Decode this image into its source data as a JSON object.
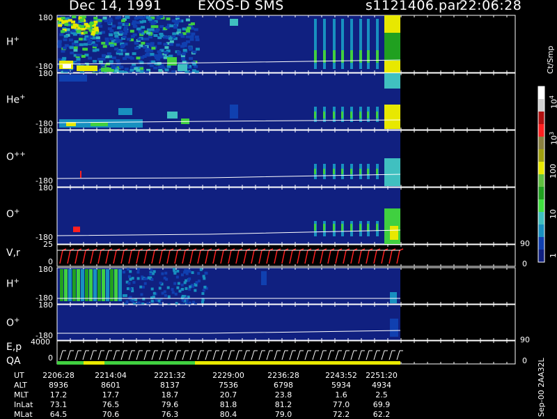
{
  "header": {
    "date": "Dec 14, 1991",
    "mission": "EXOS-D SMS",
    "file": "s1121406.par",
    "time": "22:06:28"
  },
  "panels": [
    {
      "label": "H",
      "sup": "+",
      "ymax": "180",
      "ymin": "-180"
    },
    {
      "label": "He",
      "sup": "+",
      "ymax": "180",
      "ymin": "-180"
    },
    {
      "label": "O",
      "sup": "++",
      "ymax": "180",
      "ymin": "-180"
    },
    {
      "label": "O",
      "sup": "+",
      "ymax": "180",
      "ymin": "-180"
    },
    {
      "label": "V,r",
      "sup": "",
      "ymax": "25",
      "ymin": "0",
      "right_top": "90",
      "right_bottom": "0"
    },
    {
      "label": "H",
      "sup": "+",
      "ymax": "180",
      "ymin": "-180"
    },
    {
      "label": "O",
      "sup": "+",
      "ymax": "180",
      "ymin": "-180"
    },
    {
      "label": "E,p",
      "label2": "QA",
      "ymax": "4000",
      "ymin": "0",
      "right_top": "90",
      "right_bottom": "0"
    }
  ],
  "colorbar": {
    "title": "Ct/Smp",
    "ticks": [
      "10^4",
      "10^3",
      "100",
      "10",
      "1"
    ],
    "colors": [
      "#ffffff",
      "#d0d0d0",
      "#b01010",
      "#ff2020",
      "#8a8040",
      "#a0a010",
      "#e8e800",
      "#60c040",
      "#20a020",
      "#40e040",
      "#40c0c0",
      "#1890c0",
      "#1040b0",
      "#102080"
    ]
  },
  "footer": {
    "version": "Sep-00 2AA32L",
    "row_labels": [
      "UT",
      "ALT",
      "MLT",
      "InLat",
      "MLat"
    ],
    "columns": [
      {
        "UT": "2206:28",
        "ALT": "8936",
        "MLT": "17.2",
        "InLat": "73.1",
        "MLat": "64.5"
      },
      {
        "UT": "2214:04",
        "ALT": "8601",
        "MLT": "17.7",
        "InLat": "76.5",
        "MLat": "70.6"
      },
      {
        "UT": "2221:32",
        "ALT": "8137",
        "MLT": "18.7",
        "InLat": "79.6",
        "MLat": "76.3"
      },
      {
        "UT": "2229:00",
        "ALT": "7536",
        "MLT": "20.7",
        "InLat": "81.8",
        "MLat": "80.4"
      },
      {
        "UT": "2236:28",
        "ALT": "6798",
        "MLT": "23.8",
        "InLat": "81.2",
        "MLat": "79.0"
      },
      {
        "UT": "2243:52",
        "ALT": "5934",
        "MLT": "1.6",
        "InLat": "77.0",
        "MLat": "72.2"
      },
      {
        "UT": "2251:20",
        "ALT": "4934",
        "MLT": "2.5",
        "InLat": "69.9",
        "MLat": "62.2"
      }
    ]
  },
  "chart_data": {
    "type": "heatmap",
    "x_ticks": [
      "2206:28",
      "2214:04",
      "2221:32",
      "2229:00",
      "2236:28",
      "2243:52",
      "2251:20"
    ],
    "panels": [
      "H+",
      "He+",
      "O++",
      "O+",
      "V,r",
      "H+",
      "O+",
      "E,p / QA"
    ],
    "pitch_angle_range": [
      -180,
      180
    ],
    "colorbar_unit": "Ct/Smp",
    "colorbar_range": [
      1,
      10000
    ],
    "colorbar_scale": "log"
  }
}
